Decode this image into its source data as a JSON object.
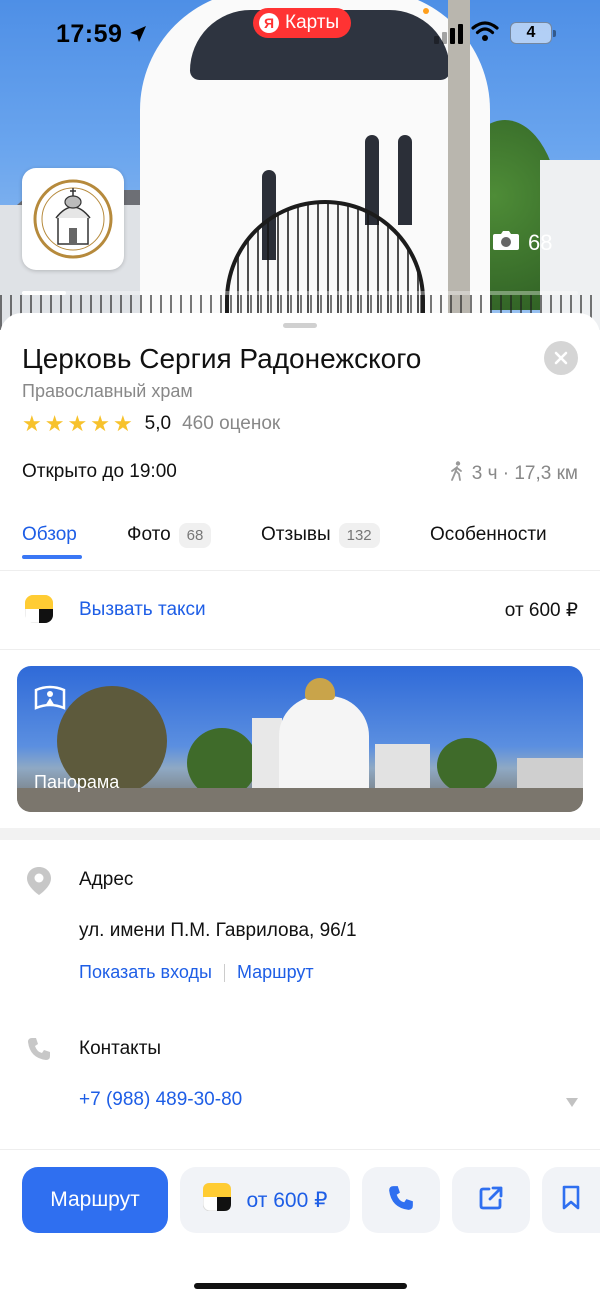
{
  "status_bar": {
    "time": "17:59",
    "app_badge": "Карты",
    "app_badge_logo": "Я",
    "battery": "4"
  },
  "hero": {
    "photo_count": "68",
    "gallery_progress": 0.08
  },
  "place": {
    "name": "Церковь Сергия Радонежского",
    "category": "Православный храм",
    "rating": "5,0",
    "stars": 5,
    "reviews_count": "460 оценок",
    "open_status": "Открыто до 19:00",
    "walk_info": "3 ч · 17,3 км"
  },
  "tabs": [
    {
      "label": "Обзор",
      "count": ""
    },
    {
      "label": "Фото",
      "count": "68"
    },
    {
      "label": "Отзывы",
      "count": "132"
    },
    {
      "label": "Особенности",
      "count": ""
    }
  ],
  "taxi": {
    "label": "Вызвать такси",
    "price": "от 600 ₽"
  },
  "panorama": {
    "label": "Панорама"
  },
  "address": {
    "heading": "Адрес",
    "text": "ул. имени П.М. Гаврилова, 96/1",
    "show_entrances": "Показать входы",
    "route_link": "Маршрут"
  },
  "contacts": {
    "heading": "Контакты",
    "phone": "+7 (988) 489-30-80"
  },
  "bottom_bar": {
    "route_button": "Маршрут",
    "taxi_button": "от 600 ₽",
    "icons": [
      "phone-icon",
      "share-icon",
      "bookmark-icon"
    ]
  },
  "colors": {
    "accent": "#2f6ff0",
    "link": "#1e5ee6",
    "star": "#f7c22c",
    "brand_red": "#ff3333"
  }
}
